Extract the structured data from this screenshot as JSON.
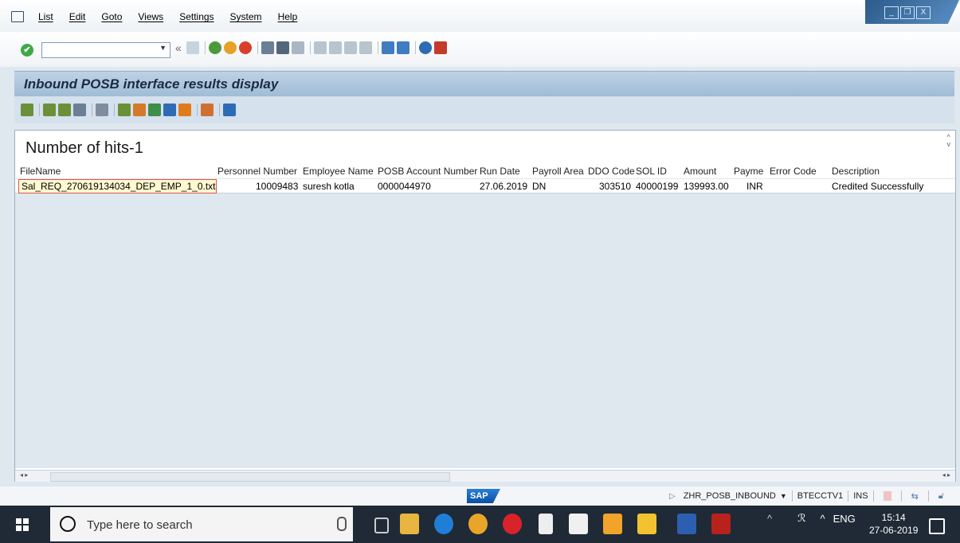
{
  "menu": {
    "items": [
      "List",
      "Edit",
      "Goto",
      "Views",
      "Settings",
      "System",
      "Help"
    ]
  },
  "window": {
    "minimize": "_",
    "restore": "❐",
    "close": "X"
  },
  "title": "Inbound POSB interface results display",
  "hits_label": "Number of hits-1",
  "table": {
    "columns": [
      "FileName",
      "Personnel Number",
      "Employee Name",
      "POSB Account Number",
      "Run Date",
      "Payroll Area",
      "DDO Code",
      "SOL ID",
      "Amount",
      "Payme",
      "Error Code",
      "Description"
    ],
    "rows": [
      [
        "Sal_REQ_270619134034_DEP_EMP_1_0.txt",
        "10009483",
        "suresh kotla",
        "0000044970",
        "27.06.2019",
        "DN",
        "303510",
        "40000199",
        "139993.00",
        "INR",
        "",
        "Credited Successfully"
      ]
    ]
  },
  "status": {
    "logo": "SAP",
    "transaction": "ZHR_POSB_INBOUND",
    "system": "BTECCTV1",
    "mode": "INS"
  },
  "taskbar": {
    "search_placeholder": "Type here to search",
    "language": "ENG",
    "time": "15:14",
    "date": "27-06-2019"
  }
}
